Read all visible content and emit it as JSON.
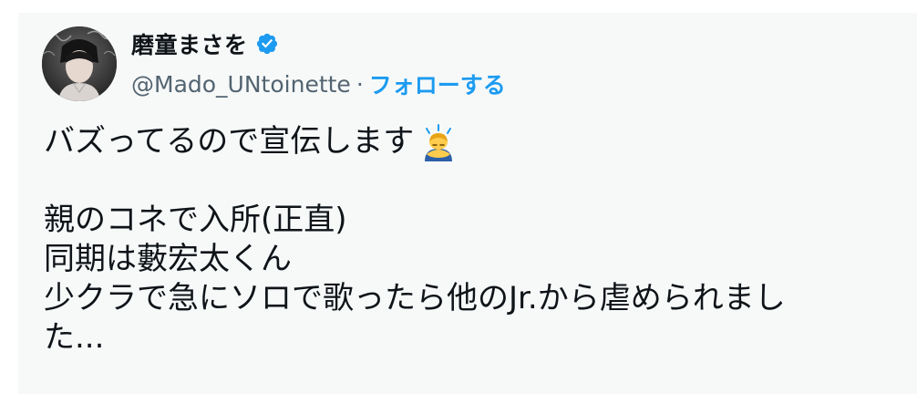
{
  "tweet": {
    "author": {
      "display_name": "磨童まさを",
      "handle": "@Mado_UNtoinette",
      "separator": "·",
      "follow_label": "フォローする",
      "verified_icon": "verified-badge-icon",
      "verified_color": "#1d9bf0"
    },
    "lines": {
      "l1": "バズってるので宣伝します",
      "l1_emoji": "person-bowing-emoji",
      "l2": "親のコネで入所(正直)",
      "l3": "同期は藪宏太くん",
      "l4": "少クラで急にソロで歌ったら他のJr.から虐められまし",
      "l5": "た..."
    }
  },
  "colors": {
    "card_background": "#f7f9f9",
    "text": "#0f1419",
    "secondary_text": "#536471",
    "accent": "#1d9bf0"
  }
}
